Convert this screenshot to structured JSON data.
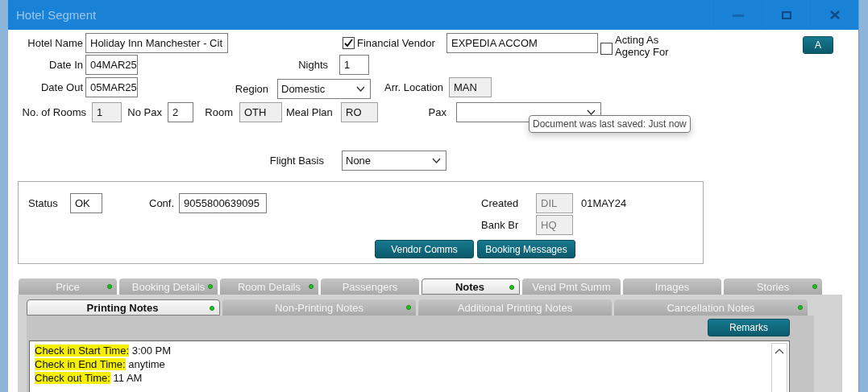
{
  "window": {
    "title": "Hotel Segment"
  },
  "form": {
    "hotel_name": {
      "label": "Hotel Name",
      "value": "Holiday Inn Manchester - Cit"
    },
    "financial_vendor": {
      "label": "Financial Vendor",
      "checked": true,
      "value": "EXPEDIA ACCOM"
    },
    "acting_as_agency": {
      "label": "Acting As Agency For",
      "checked": false
    },
    "a_button": "A",
    "date_in": {
      "label": "Date In",
      "value": "04MAR25"
    },
    "nights": {
      "label": "Nights",
      "value": "1"
    },
    "date_out": {
      "label": "Date Out",
      "value": "05MAR25"
    },
    "region": {
      "label": "Region",
      "value": "Domestic"
    },
    "arr_location": {
      "label": "Arr. Location",
      "value": "MAN",
      "readonly": true
    },
    "rooms": {
      "label": "No. of Rooms",
      "value": "1",
      "readonly": true
    },
    "no_pax": {
      "label": "No Pax",
      "value": "2",
      "readonly": false
    },
    "room": {
      "label": "Room",
      "value": "OTH",
      "readonly": true
    },
    "meal_plan": {
      "label": "Meal Plan",
      "value": "RO",
      "readonly": true
    },
    "pax": {
      "label": "Pax"
    },
    "tooltip": "Document was last saved: Just now",
    "flight_basis": {
      "label": "Flight Basis",
      "value": "None"
    }
  },
  "booking": {
    "status": {
      "label": "Status",
      "value": "OK"
    },
    "conf": {
      "label": "Conf.",
      "value": "9055800639095"
    },
    "created": {
      "label": "Created",
      "value": "DIL",
      "readonly": true,
      "date": "01MAY24"
    },
    "bank_br": {
      "label": "Bank Br",
      "value": "HQ",
      "readonly": true
    },
    "buttons": [
      "Vendor Comms",
      "Booking Messages"
    ]
  },
  "tabs": [
    {
      "label": "Price",
      "selected": false,
      "indicator": true
    },
    {
      "label": "Booking Details",
      "selected": false,
      "indicator": true
    },
    {
      "label": "Room Details",
      "selected": false,
      "indicator": true
    },
    {
      "label": "Passengers",
      "selected": false,
      "indicator": false
    },
    {
      "label": "Notes",
      "selected": true,
      "indicator": true
    },
    {
      "label": "Vend Pmt Summ",
      "selected": false,
      "indicator": false
    },
    {
      "label": "Images",
      "selected": false,
      "indicator": false
    },
    {
      "label": "Stories",
      "selected": false,
      "indicator": true
    }
  ],
  "subtabs": [
    {
      "label": "Printing Notes",
      "selected": true,
      "indicator": true
    },
    {
      "label": "Non-Printing Notes",
      "selected": false,
      "indicator": true
    },
    {
      "label": "Additional Printing Notes",
      "selected": false,
      "indicator": false
    },
    {
      "label": "Cancellation Notes",
      "selected": false,
      "indicator": true
    }
  ],
  "remarks_button": "Remarks",
  "notes": [
    {
      "label": "Check in Start Time:",
      "value": "3:00 PM",
      "highlighted": true
    },
    {
      "label": "Check in End Time:",
      "value": "anytime",
      "highlighted": true
    },
    {
      "label": "Check out Time:",
      "value": "11 AM",
      "highlighted": true
    }
  ]
}
